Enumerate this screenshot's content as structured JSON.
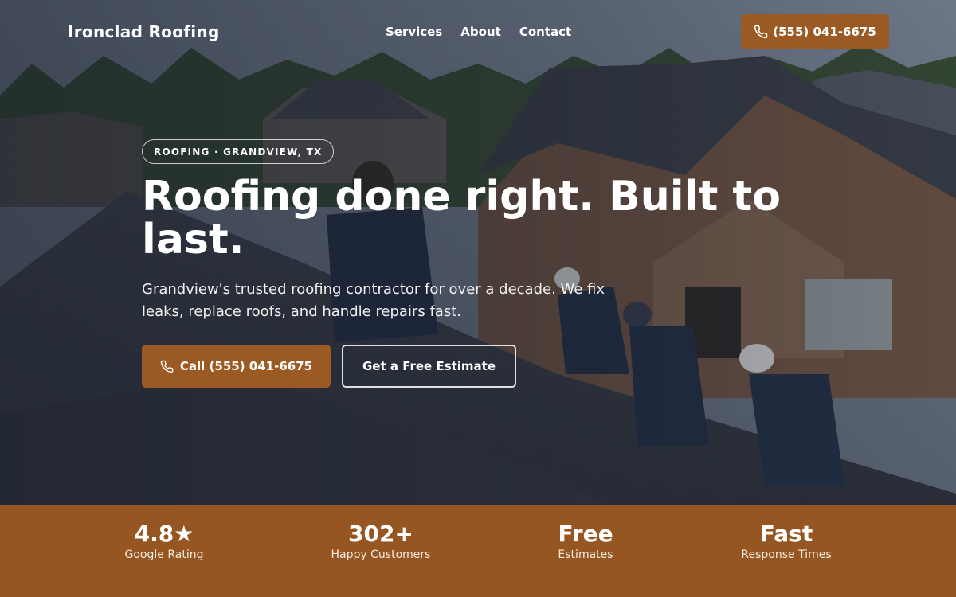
{
  "nav": {
    "brand": "Ironclad Roofing",
    "links": [
      "Services",
      "About",
      "Contact"
    ],
    "phone": "(555) 041-6675"
  },
  "hero": {
    "badge": "ROOFING · GRANDVIEW, TX",
    "headline": "Roofing done right. Built to last.",
    "subtitle": "Grandview's trusted roofing contractor for over a decade. We fix leaks, replace roofs, and handle repairs fast.",
    "primary_cta": "Call (555) 041-6675",
    "secondary_cta": "Get a Free Estimate",
    "background_icon": "roofers-on-roof-photo"
  },
  "stats": [
    {
      "value": "4.8★",
      "label": "Google Rating"
    },
    {
      "value": "302+",
      "label": "Happy Customers"
    },
    {
      "value": "Free",
      "label": "Estimates"
    },
    {
      "value": "Fast",
      "label": "Response Times"
    }
  ],
  "colors": {
    "accent": "#9b5a23",
    "stats_bar": "#955622"
  }
}
